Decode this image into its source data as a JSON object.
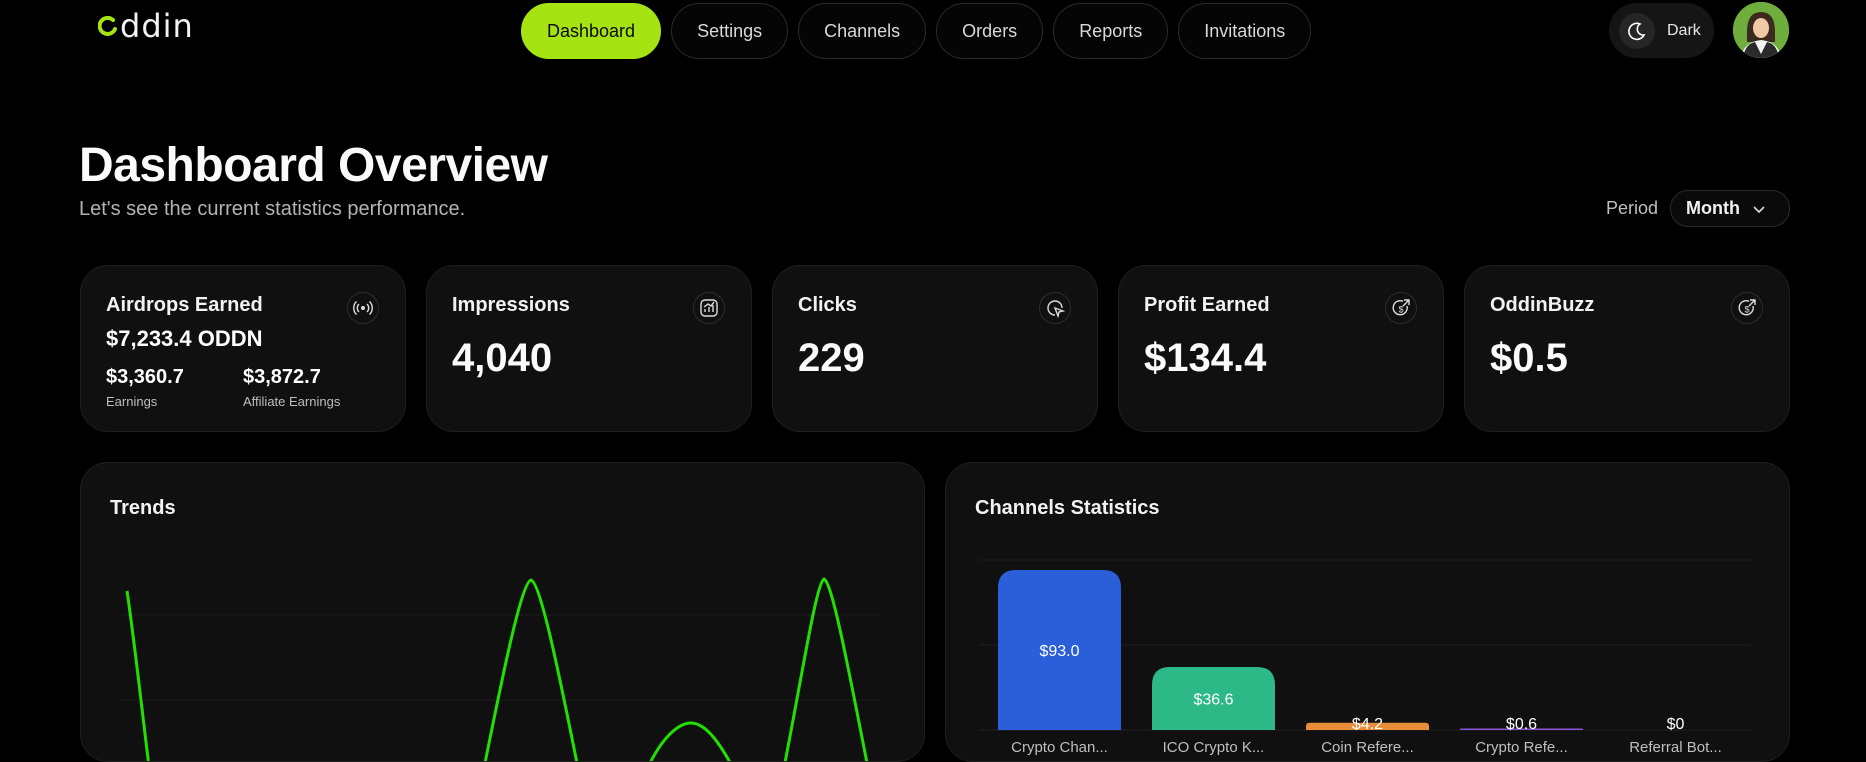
{
  "app": {
    "logo_text": "ddin"
  },
  "nav": {
    "items": [
      {
        "label": "Dashboard",
        "active": true
      },
      {
        "label": "Settings",
        "active": false
      },
      {
        "label": "Channels",
        "active": false
      },
      {
        "label": "Orders",
        "active": false
      },
      {
        "label": "Reports",
        "active": false
      },
      {
        "label": "Invitations",
        "active": false
      }
    ]
  },
  "theme": {
    "label": "Dark",
    "icon": "moon-icon"
  },
  "header": {
    "title": "Dashboard Overview",
    "subtitle": "Let's see the current statistics performance."
  },
  "period": {
    "label": "Period",
    "value": "Month"
  },
  "cards": {
    "airdrops": {
      "title": "Airdrops Earned",
      "value": "$7,233.4 ODDN",
      "earnings_value": "$3,360.7",
      "earnings_label": "Earnings",
      "affiliate_value": "$3,872.7",
      "affiliate_label": "Affiliate Earnings",
      "icon": "broadcast-icon"
    },
    "impressions": {
      "title": "Impressions",
      "value": "4,040",
      "icon": "chart-icon"
    },
    "clicks": {
      "title": "Clicks",
      "value": "229",
      "icon": "cursor-click-icon"
    },
    "profit": {
      "title": "Profit Earned",
      "value": "$134.4",
      "icon": "dollar-arrow-icon"
    },
    "oddinbuzz": {
      "title": "OddinBuzz",
      "value": "$0.5",
      "icon": "dollar-arrow-icon"
    }
  },
  "trends": {
    "title": "Trends"
  },
  "channels": {
    "title": "Channels Statistics"
  },
  "colors": {
    "accent": "#a6e313",
    "trend_line": "#22e000",
    "bar_blue": "#2a5fd9",
    "bar_green": "#2db888",
    "bar_orange": "#e98c3a",
    "bar_purple": "#8a55d6"
  },
  "chart_data": [
    {
      "type": "line",
      "title": "Trends",
      "note": "curve visible, axes cut off"
    },
    {
      "type": "bar",
      "title": "Channels Statistics",
      "categories": [
        "Crypto Chan...",
        "ICO Crypto K...",
        "Coin Refere...",
        "Crypto Refe...",
        "Referral Bot..."
      ],
      "values": [
        93.0,
        36.6,
        4.2,
        0.6,
        0
      ],
      "labels": [
        "$93.0",
        "$36.6",
        "$4.2",
        "$0.6",
        "$0"
      ]
    }
  ]
}
